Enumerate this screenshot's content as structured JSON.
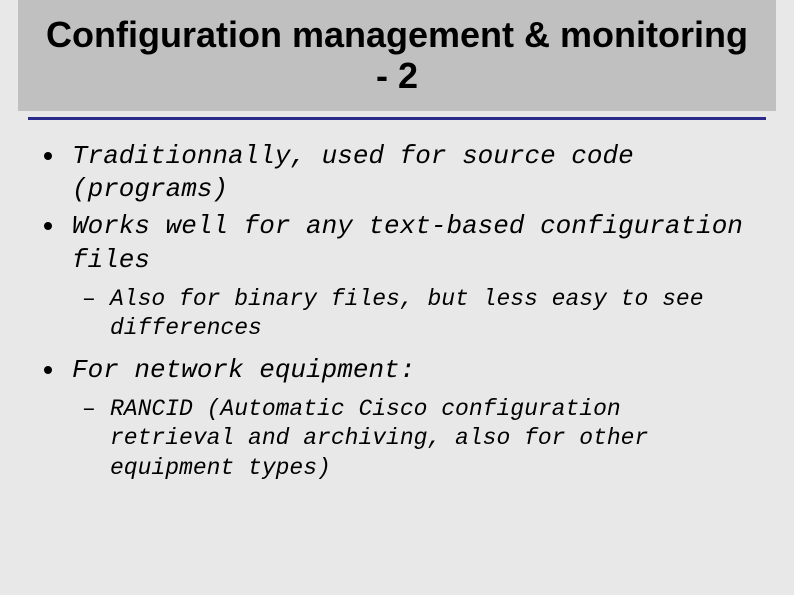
{
  "title": "Configuration management & monitoring - 2",
  "bullets": {
    "b1": "Traditionnally, used for source code (programs)",
    "b2": "Works well for any text-based configuration files",
    "b2_sub1": "Also for binary files, but less easy to see differences",
    "b3": "For network equipment:",
    "b3_sub1": "RANCID (Automatic Cisco configuration retrieval and archiving, also for other equipment types)"
  }
}
